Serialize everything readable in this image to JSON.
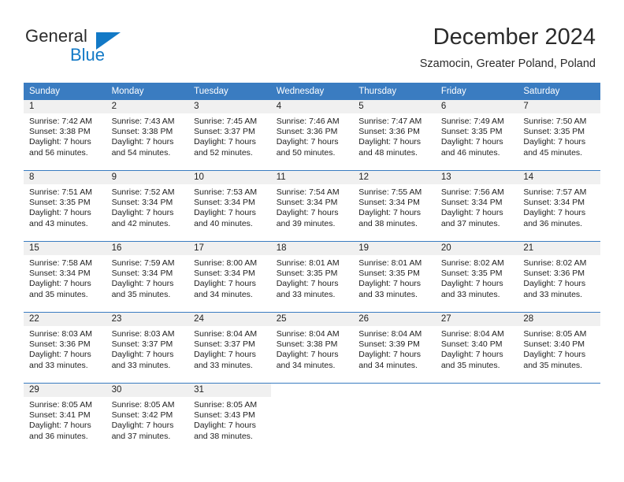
{
  "brand": {
    "name_part1": "General",
    "name_part2": "Blue"
  },
  "header": {
    "title": "December 2024",
    "subtitle": "Szamocin, Greater Poland, Poland"
  },
  "colors": {
    "header_blue": "#3a7cc1",
    "brand_blue": "#1279c6",
    "daynum_strip": "#f0f0f0",
    "text": "#222222"
  },
  "weekday_headers": [
    "Sunday",
    "Monday",
    "Tuesday",
    "Wednesday",
    "Thursday",
    "Friday",
    "Saturday"
  ],
  "weeks": [
    [
      {
        "day": "1",
        "sunrise": "Sunrise: 7:42 AM",
        "sunset": "Sunset: 3:38 PM",
        "daylight_line1": "Daylight: 7 hours",
        "daylight_line2": "and 56 minutes."
      },
      {
        "day": "2",
        "sunrise": "Sunrise: 7:43 AM",
        "sunset": "Sunset: 3:38 PM",
        "daylight_line1": "Daylight: 7 hours",
        "daylight_line2": "and 54 minutes."
      },
      {
        "day": "3",
        "sunrise": "Sunrise: 7:45 AM",
        "sunset": "Sunset: 3:37 PM",
        "daylight_line1": "Daylight: 7 hours",
        "daylight_line2": "and 52 minutes."
      },
      {
        "day": "4",
        "sunrise": "Sunrise: 7:46 AM",
        "sunset": "Sunset: 3:36 PM",
        "daylight_line1": "Daylight: 7 hours",
        "daylight_line2": "and 50 minutes."
      },
      {
        "day": "5",
        "sunrise": "Sunrise: 7:47 AM",
        "sunset": "Sunset: 3:36 PM",
        "daylight_line1": "Daylight: 7 hours",
        "daylight_line2": "and 48 minutes."
      },
      {
        "day": "6",
        "sunrise": "Sunrise: 7:49 AM",
        "sunset": "Sunset: 3:35 PM",
        "daylight_line1": "Daylight: 7 hours",
        "daylight_line2": "and 46 minutes."
      },
      {
        "day": "7",
        "sunrise": "Sunrise: 7:50 AM",
        "sunset": "Sunset: 3:35 PM",
        "daylight_line1": "Daylight: 7 hours",
        "daylight_line2": "and 45 minutes."
      }
    ],
    [
      {
        "day": "8",
        "sunrise": "Sunrise: 7:51 AM",
        "sunset": "Sunset: 3:35 PM",
        "daylight_line1": "Daylight: 7 hours",
        "daylight_line2": "and 43 minutes."
      },
      {
        "day": "9",
        "sunrise": "Sunrise: 7:52 AM",
        "sunset": "Sunset: 3:34 PM",
        "daylight_line1": "Daylight: 7 hours",
        "daylight_line2": "and 42 minutes."
      },
      {
        "day": "10",
        "sunrise": "Sunrise: 7:53 AM",
        "sunset": "Sunset: 3:34 PM",
        "daylight_line1": "Daylight: 7 hours",
        "daylight_line2": "and 40 minutes."
      },
      {
        "day": "11",
        "sunrise": "Sunrise: 7:54 AM",
        "sunset": "Sunset: 3:34 PM",
        "daylight_line1": "Daylight: 7 hours",
        "daylight_line2": "and 39 minutes."
      },
      {
        "day": "12",
        "sunrise": "Sunrise: 7:55 AM",
        "sunset": "Sunset: 3:34 PM",
        "daylight_line1": "Daylight: 7 hours",
        "daylight_line2": "and 38 minutes."
      },
      {
        "day": "13",
        "sunrise": "Sunrise: 7:56 AM",
        "sunset": "Sunset: 3:34 PM",
        "daylight_line1": "Daylight: 7 hours",
        "daylight_line2": "and 37 minutes."
      },
      {
        "day": "14",
        "sunrise": "Sunrise: 7:57 AM",
        "sunset": "Sunset: 3:34 PM",
        "daylight_line1": "Daylight: 7 hours",
        "daylight_line2": "and 36 minutes."
      }
    ],
    [
      {
        "day": "15",
        "sunrise": "Sunrise: 7:58 AM",
        "sunset": "Sunset: 3:34 PM",
        "daylight_line1": "Daylight: 7 hours",
        "daylight_line2": "and 35 minutes."
      },
      {
        "day": "16",
        "sunrise": "Sunrise: 7:59 AM",
        "sunset": "Sunset: 3:34 PM",
        "daylight_line1": "Daylight: 7 hours",
        "daylight_line2": "and 35 minutes."
      },
      {
        "day": "17",
        "sunrise": "Sunrise: 8:00 AM",
        "sunset": "Sunset: 3:34 PM",
        "daylight_line1": "Daylight: 7 hours",
        "daylight_line2": "and 34 minutes."
      },
      {
        "day": "18",
        "sunrise": "Sunrise: 8:01 AM",
        "sunset": "Sunset: 3:35 PM",
        "daylight_line1": "Daylight: 7 hours",
        "daylight_line2": "and 33 minutes."
      },
      {
        "day": "19",
        "sunrise": "Sunrise: 8:01 AM",
        "sunset": "Sunset: 3:35 PM",
        "daylight_line1": "Daylight: 7 hours",
        "daylight_line2": "and 33 minutes."
      },
      {
        "day": "20",
        "sunrise": "Sunrise: 8:02 AM",
        "sunset": "Sunset: 3:35 PM",
        "daylight_line1": "Daylight: 7 hours",
        "daylight_line2": "and 33 minutes."
      },
      {
        "day": "21",
        "sunrise": "Sunrise: 8:02 AM",
        "sunset": "Sunset: 3:36 PM",
        "daylight_line1": "Daylight: 7 hours",
        "daylight_line2": "and 33 minutes."
      }
    ],
    [
      {
        "day": "22",
        "sunrise": "Sunrise: 8:03 AM",
        "sunset": "Sunset: 3:36 PM",
        "daylight_line1": "Daylight: 7 hours",
        "daylight_line2": "and 33 minutes."
      },
      {
        "day": "23",
        "sunrise": "Sunrise: 8:03 AM",
        "sunset": "Sunset: 3:37 PM",
        "daylight_line1": "Daylight: 7 hours",
        "daylight_line2": "and 33 minutes."
      },
      {
        "day": "24",
        "sunrise": "Sunrise: 8:04 AM",
        "sunset": "Sunset: 3:37 PM",
        "daylight_line1": "Daylight: 7 hours",
        "daylight_line2": "and 33 minutes."
      },
      {
        "day": "25",
        "sunrise": "Sunrise: 8:04 AM",
        "sunset": "Sunset: 3:38 PM",
        "daylight_line1": "Daylight: 7 hours",
        "daylight_line2": "and 34 minutes."
      },
      {
        "day": "26",
        "sunrise": "Sunrise: 8:04 AM",
        "sunset": "Sunset: 3:39 PM",
        "daylight_line1": "Daylight: 7 hours",
        "daylight_line2": "and 34 minutes."
      },
      {
        "day": "27",
        "sunrise": "Sunrise: 8:04 AM",
        "sunset": "Sunset: 3:40 PM",
        "daylight_line1": "Daylight: 7 hours",
        "daylight_line2": "and 35 minutes."
      },
      {
        "day": "28",
        "sunrise": "Sunrise: 8:05 AM",
        "sunset": "Sunset: 3:40 PM",
        "daylight_line1": "Daylight: 7 hours",
        "daylight_line2": "and 35 minutes."
      }
    ],
    [
      {
        "day": "29",
        "sunrise": "Sunrise: 8:05 AM",
        "sunset": "Sunset: 3:41 PM",
        "daylight_line1": "Daylight: 7 hours",
        "daylight_line2": "and 36 minutes."
      },
      {
        "day": "30",
        "sunrise": "Sunrise: 8:05 AM",
        "sunset": "Sunset: 3:42 PM",
        "daylight_line1": "Daylight: 7 hours",
        "daylight_line2": "and 37 minutes."
      },
      {
        "day": "31",
        "sunrise": "Sunrise: 8:05 AM",
        "sunset": "Sunset: 3:43 PM",
        "daylight_line1": "Daylight: 7 hours",
        "daylight_line2": "and 38 minutes."
      },
      {
        "day": "",
        "sunrise": "",
        "sunset": "",
        "daylight_line1": "",
        "daylight_line2": ""
      },
      {
        "day": "",
        "sunrise": "",
        "sunset": "",
        "daylight_line1": "",
        "daylight_line2": ""
      },
      {
        "day": "",
        "sunrise": "",
        "sunset": "",
        "daylight_line1": "",
        "daylight_line2": ""
      },
      {
        "day": "",
        "sunrise": "",
        "sunset": "",
        "daylight_line1": "",
        "daylight_line2": ""
      }
    ]
  ]
}
